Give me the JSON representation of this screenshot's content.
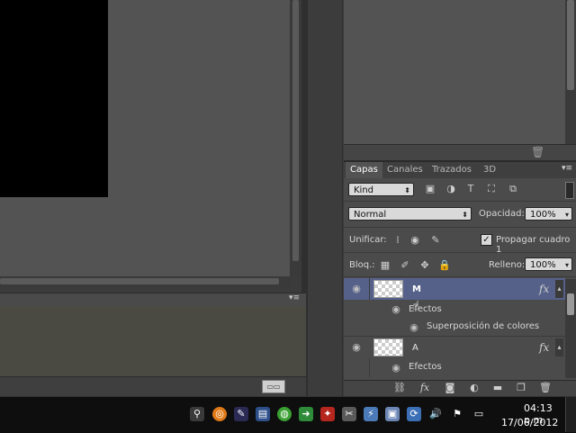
{
  "layers_panel": {
    "tabs": [
      "Capas",
      "Canales",
      "Trazados",
      "3D"
    ],
    "kind_filter": "Kind",
    "blend_mode": "Normal",
    "opacity_label": "Opacidad:",
    "opacity_value": "100%",
    "unify_label": "Unificar:",
    "propagate_label": "Propagar cuadro 1",
    "propagate_checked": true,
    "lock_label": "Bloq.:",
    "fill_label": "Relleno:",
    "fill_value": "100%",
    "layers": [
      {
        "name": "M",
        "selected": true,
        "effects_label": "Efectos",
        "effect": "Superposición de colores",
        "fx": "fx"
      },
      {
        "name": "A",
        "selected": false,
        "effects_label": "Efectos",
        "fx": "fx"
      }
    ]
  },
  "taskbar": {
    "time": "04:13 p.m.",
    "date": "17/06/2012",
    "tray_icons": [
      "pin-icon",
      "orange-app-icon",
      "pen-app-icon",
      "paint-icon",
      "network-icon",
      "green-arrow-icon",
      "shield-icon",
      "acrobat-icon",
      "tools-icon",
      "vpn-icon",
      "photo-icon",
      "updater-icon",
      "volume-icon",
      "flag-icon",
      "display-icon"
    ]
  },
  "colors": {
    "selected_layer": "#56618a",
    "panel_bg": "#4b4b4b",
    "taskbar_bg": "#0e0e0e"
  }
}
